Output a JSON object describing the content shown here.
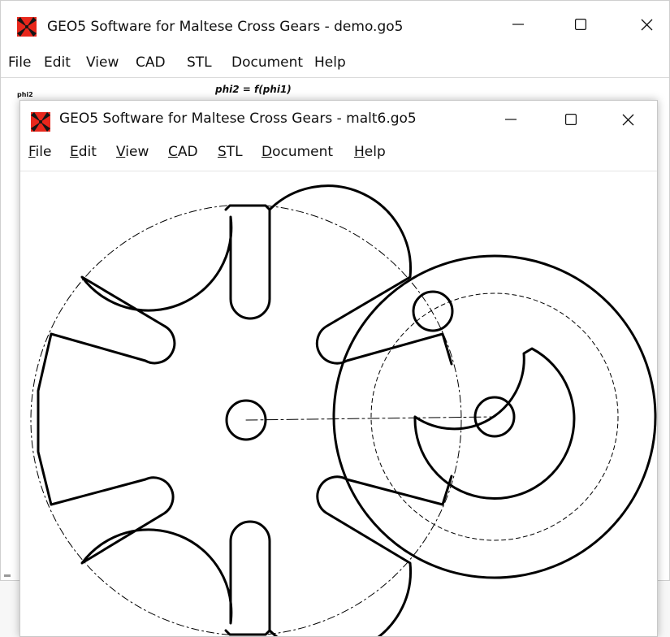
{
  "back_window": {
    "title": "GEO5  Software for Maltese Cross Gears  -  demo.go5",
    "menu": [
      "File",
      "Edit",
      "View",
      "CAD",
      "STL",
      "Document",
      "Help"
    ],
    "plot_caption": "phi2 = f(phi1)",
    "plot_ylabel": "phi2"
  },
  "front_window": {
    "title": "GEO5  Software for Maltese Cross Gears  -  malt6.go5",
    "menu": [
      "File",
      "Edit",
      "View",
      "CAD",
      "STL",
      "Document",
      "Help"
    ]
  },
  "colors": {
    "logo_red": "#e8271c",
    "logo_dark": "#151515",
    "drawing_line": "#000000"
  },
  "icons": {
    "app": "maltese-cross-logo-icon",
    "minimize": "minimize-icon",
    "maximize": "maximize-icon",
    "close": "close-icon"
  }
}
